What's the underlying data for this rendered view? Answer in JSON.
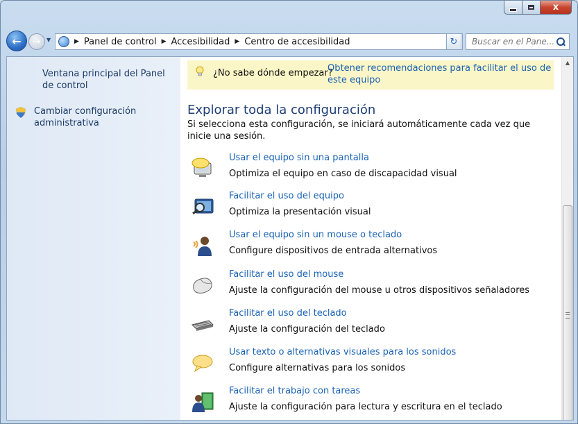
{
  "window": {
    "caption_buttons": {
      "close_glyph": "x"
    }
  },
  "navigation": {
    "breadcrumb": [
      "Panel de control",
      "Accesibilidad",
      "Centro de accesibilidad"
    ],
    "search_placeholder": "Buscar en el Pane..."
  },
  "sidebar": {
    "items": [
      {
        "label": "Ventana principal del Panel de control",
        "icon": null
      },
      {
        "label": "Cambiar configuración administrativa",
        "icon": "shield-icon"
      }
    ]
  },
  "tip": {
    "question": "¿No sabe dónde empezar?",
    "link": "Obtener recomendaciones para facilitar el uso de este equipo"
  },
  "section": {
    "title": "Explorar toda la configuración",
    "description": "Si selecciona esta configuración, se iniciará automáticamente cada vez que inicie una sesión."
  },
  "items": [
    {
      "title": "Usar el equipo sin una pantalla",
      "description": "Optimiza el equipo en caso de discapacidad visual",
      "icon": "speech-monitor-icon"
    },
    {
      "title": "Facilitar el uso del equipo",
      "description": "Optimiza la presentación visual",
      "icon": "magnifier-monitor-icon"
    },
    {
      "title": "Usar el equipo sin un mouse o teclado",
      "description": "Configure dispositivos de entrada alternativos",
      "icon": "user-speaking-icon"
    },
    {
      "title": "Facilitar el uso del mouse",
      "description": "Ajuste la configuración del mouse u otros dispositivos señaladores",
      "icon": "mouse-icon"
    },
    {
      "title": "Facilitar el uso del teclado",
      "description": "Ajuste la configuración del teclado",
      "icon": "keyboard-icon"
    },
    {
      "title": "Usar texto o alternativas visuales para los sonidos",
      "description": "Configure alternativas para los sonidos",
      "icon": "speech-bubble-icon"
    },
    {
      "title": "Facilitar el trabajo con tareas",
      "description": "Ajuste la configuración para lectura y escritura en el teclado",
      "icon": "user-book-icon"
    }
  ]
}
